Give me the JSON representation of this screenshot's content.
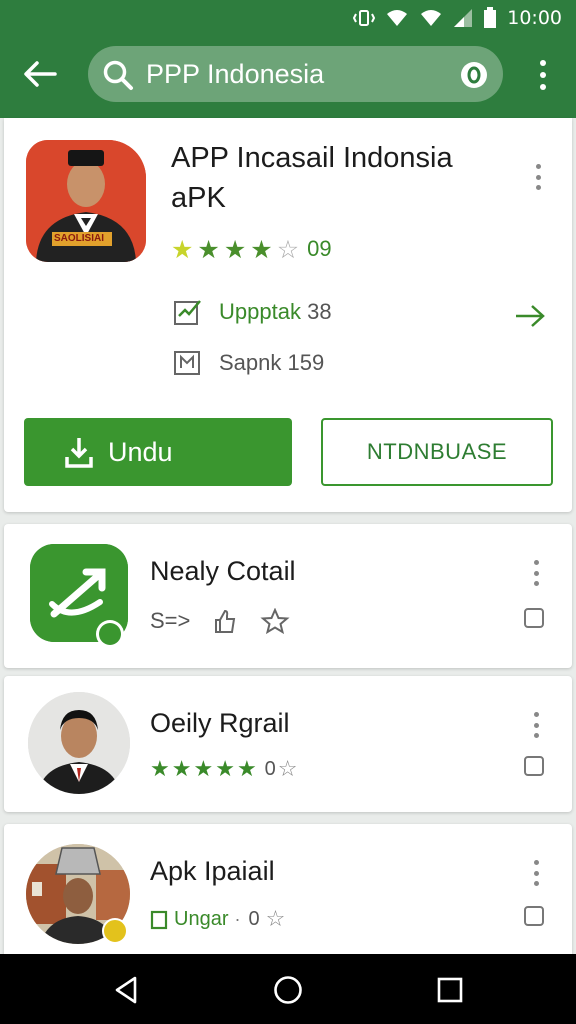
{
  "status_bar": {
    "time": "10:00"
  },
  "search": {
    "query": "PPP Indonesia"
  },
  "featured": {
    "title_line1": "APP Incasail Indonsia",
    "title_line2": "aPK",
    "badge_text": "SAOLISIAI",
    "rating_stars": 3.5,
    "rating_value": "09",
    "update_label": "Uppptak",
    "update_count": "38",
    "size_label": "Sapnk",
    "size_count": "159",
    "install_label": "Undu",
    "secondary_label": "NTDNBUASE"
  },
  "results": [
    {
      "title": "Nealy Cotail",
      "sub": "S=>"
    },
    {
      "title": "Oeily Rgrail",
      "rating_stars": 5,
      "rating_value": "0"
    },
    {
      "title": "Apk Ipaiail",
      "sub": "Ungar",
      "rating_value": "0"
    }
  ],
  "colors": {
    "appbar": "#2e7d3e",
    "accent": "#3a962f",
    "star": "#4a8f2c"
  }
}
